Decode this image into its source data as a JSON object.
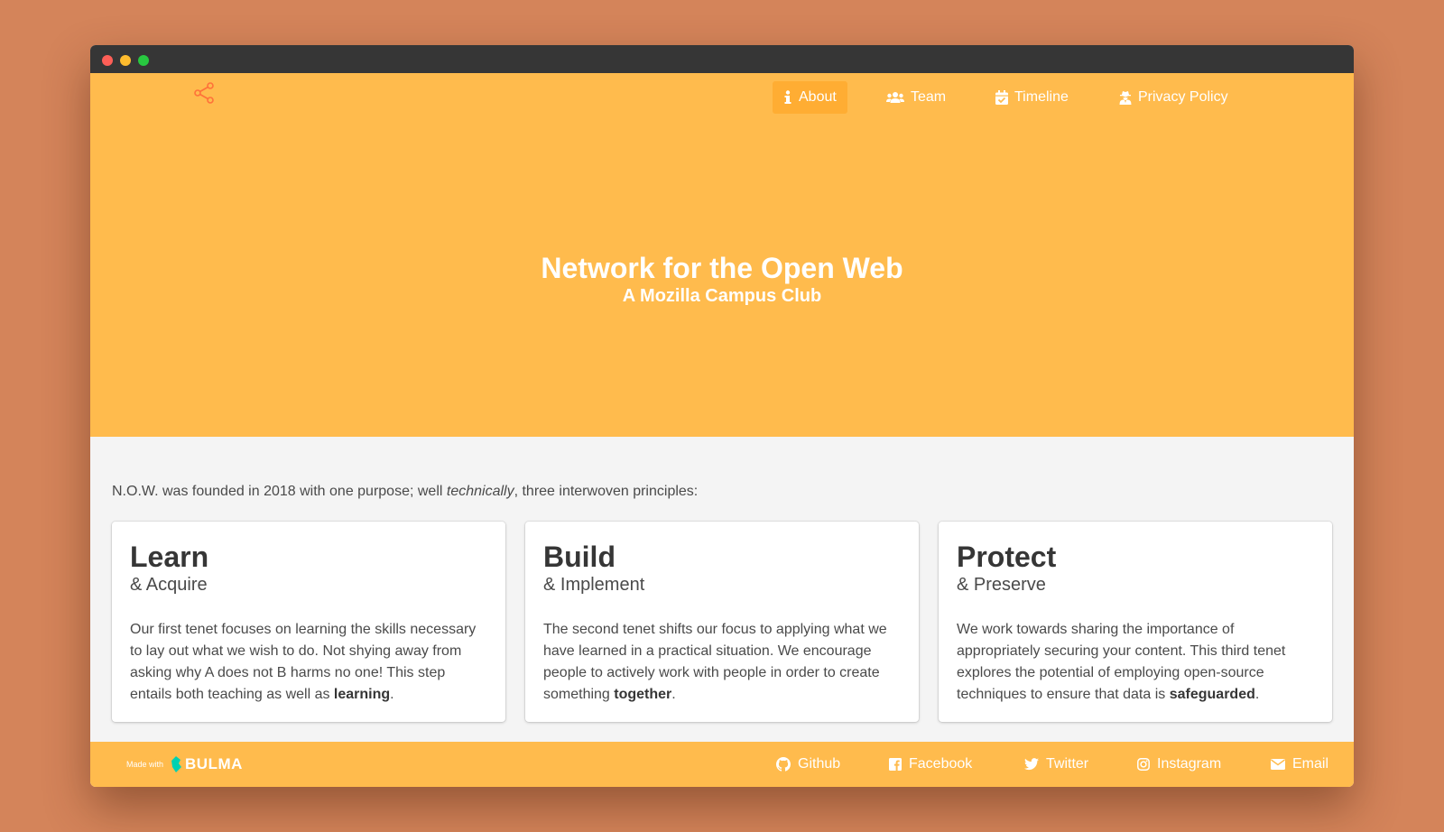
{
  "colors": {
    "background": "#d4845a",
    "titlebar": "#363636",
    "brand": "#ffbb4d",
    "nav_active": "#ffad33",
    "logo_accent": "#ff7139",
    "bulma": "#00d1b2"
  },
  "nav": {
    "logo_icon": "share-nodes-icon",
    "items": [
      {
        "label": "About",
        "icon": "info-icon",
        "active": true
      },
      {
        "label": "Team",
        "icon": "users-icon",
        "active": false
      },
      {
        "label": "Timeline",
        "icon": "calendar-check-icon",
        "active": false
      },
      {
        "label": "Privacy Policy",
        "icon": "user-secret-icon",
        "active": false
      }
    ]
  },
  "hero": {
    "title": "Network for the Open Web",
    "subtitle": "A Mozilla Campus Club"
  },
  "intro": {
    "before": "N.O.W. was founded in 2018 with one purpose; well ",
    "emphasis": "technically",
    "after": ", three interwoven principles:"
  },
  "cards": [
    {
      "title": "Learn",
      "subtitle": "& Acquire",
      "body": "Our first tenet focuses on learning the skills necessary to lay out what we wish to do. Not shying away from asking why A does not B harms no one! This step entails both teaching as well as ",
      "highlight": "learning",
      "end": "."
    },
    {
      "title": "Build",
      "subtitle": "& Implement",
      "body": "The second tenet shifts our focus to applying what we have learned in a practical situation. We encourage people to actively work with people in order to create something ",
      "highlight": "together",
      "end": "."
    },
    {
      "title": "Protect",
      "subtitle": "& Preserve",
      "body": "We work towards sharing the importance of appropriately securing your content. This third tenet explores the potential of employing open-source techniques to ensure that data is ",
      "highlight": "safeguarded",
      "end": "."
    }
  ],
  "footer": {
    "made_with": "Made with",
    "bulma": "BULMA",
    "links": [
      {
        "label": "Github",
        "icon": "github-icon"
      },
      {
        "label": "Facebook",
        "icon": "facebook-icon"
      },
      {
        "label": "Twitter",
        "icon": "twitter-icon"
      },
      {
        "label": "Instagram",
        "icon": "instagram-icon"
      },
      {
        "label": "Email",
        "icon": "envelope-icon"
      }
    ]
  }
}
